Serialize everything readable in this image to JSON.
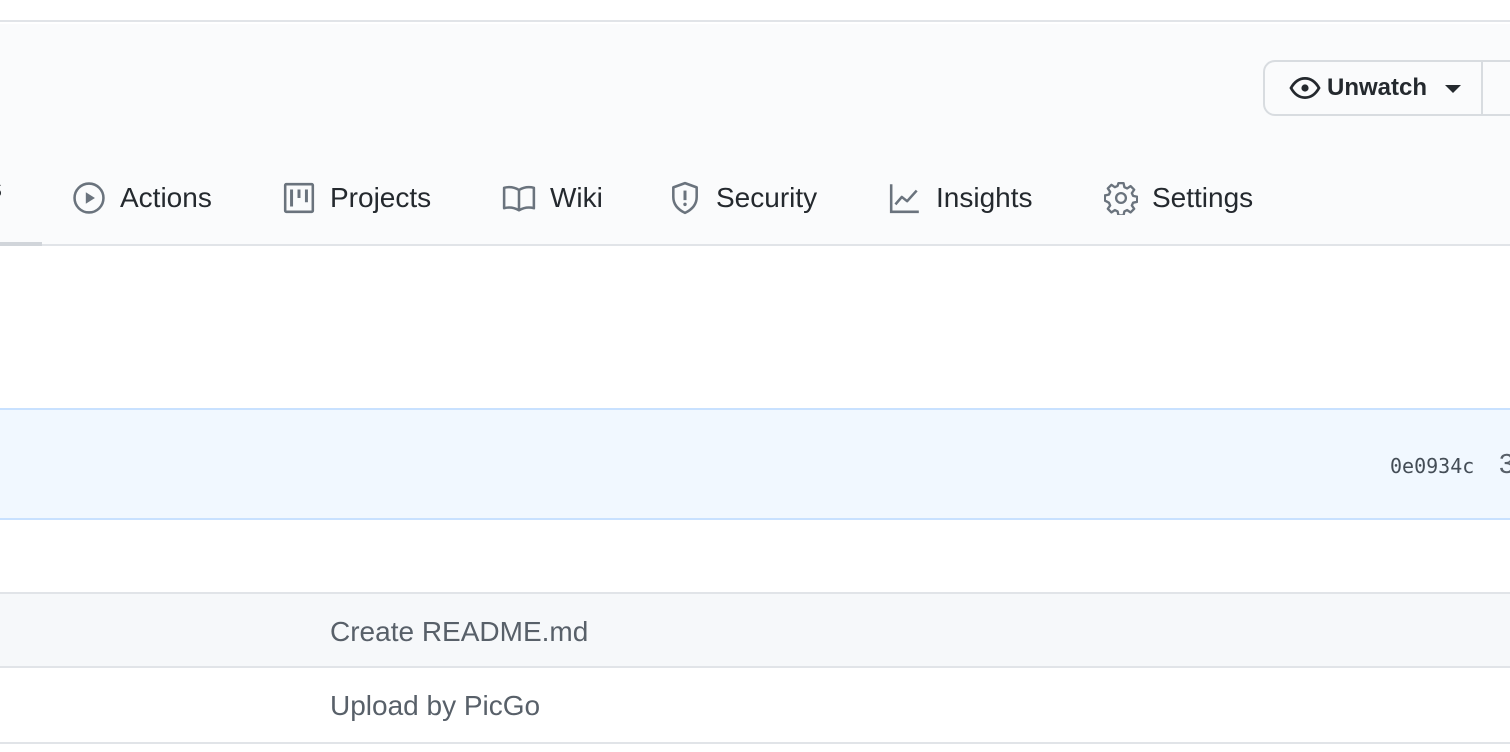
{
  "header": {
    "watch": {
      "label": "Unwatch"
    }
  },
  "tabs": {
    "partial_label": "s",
    "items": [
      {
        "label": "Actions",
        "icon": "play-icon"
      },
      {
        "label": "Projects",
        "icon": "project-icon"
      },
      {
        "label": "Wiki",
        "icon": "book-icon"
      },
      {
        "label": "Security",
        "icon": "shield-icon"
      },
      {
        "label": "Insights",
        "icon": "graph-icon"
      },
      {
        "label": "Settings",
        "icon": "gear-icon"
      }
    ]
  },
  "latest_commit": {
    "sha": "0e0934c",
    "trailing": "3"
  },
  "files": [
    {
      "message": "Create README.md"
    },
    {
      "message": "Upload by PicGo"
    }
  ],
  "colors": {
    "header_bg": "#fafbfc",
    "commit_bar_bg": "#f1f8ff",
    "border": "#e1e4e8",
    "text": "#24292e",
    "muted": "#586069",
    "icon": "#6a737d"
  }
}
